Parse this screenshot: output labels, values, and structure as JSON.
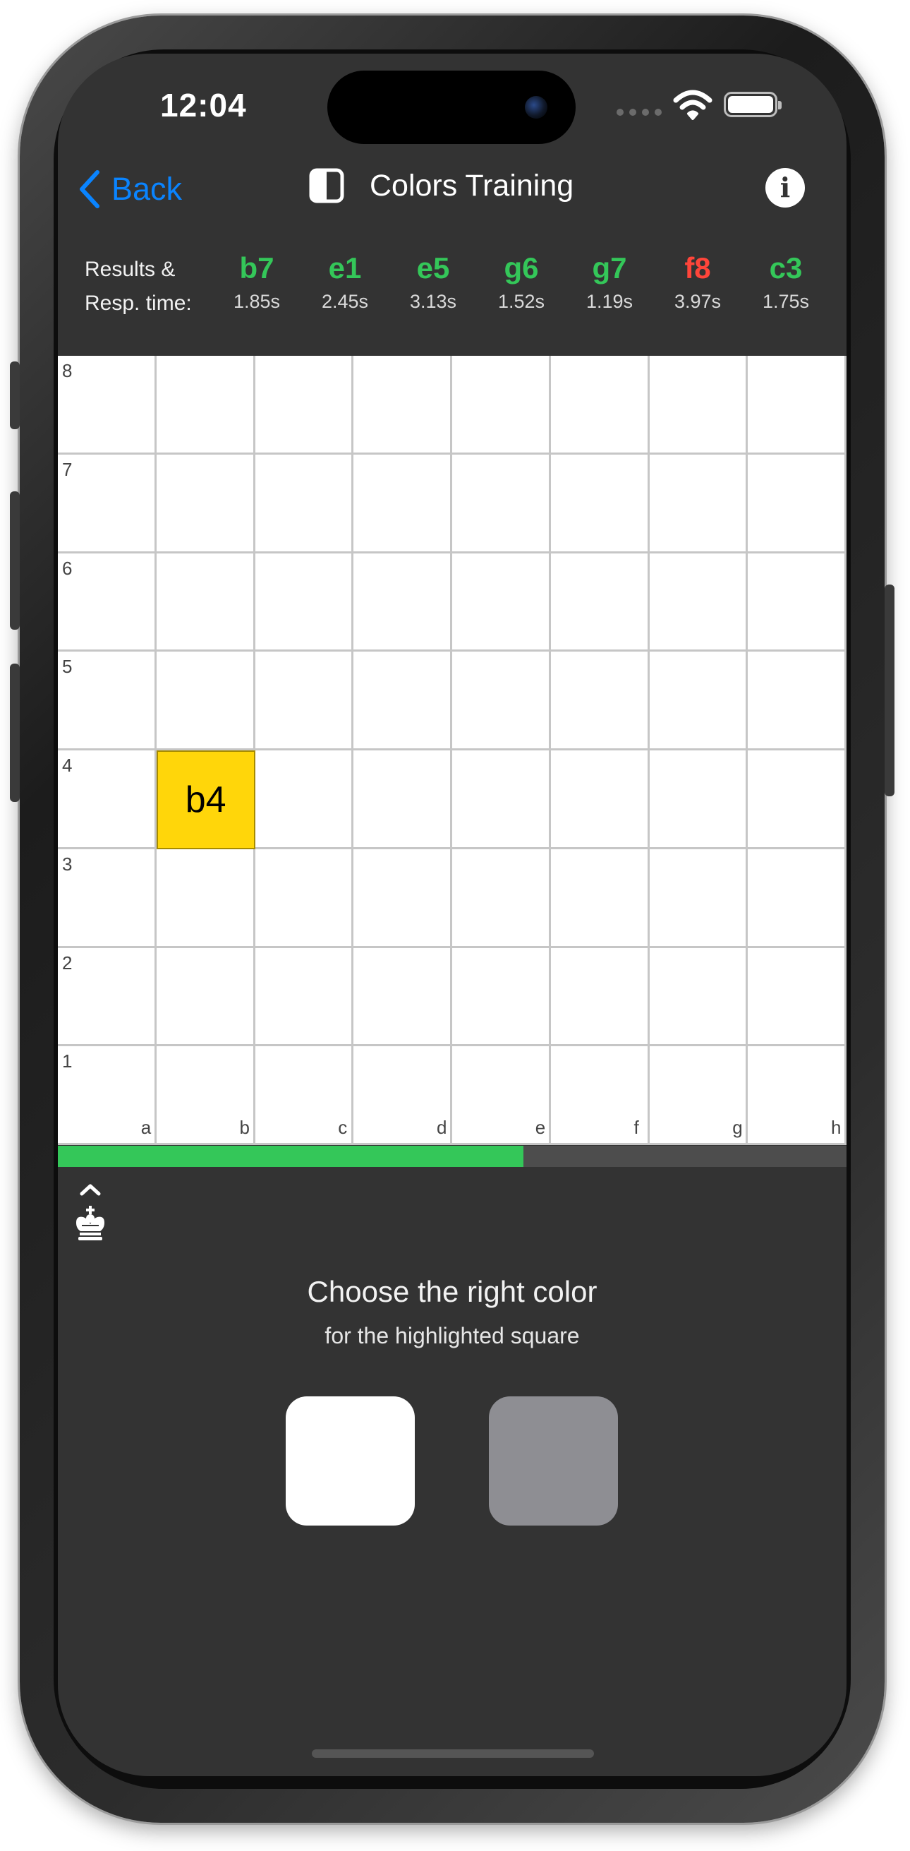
{
  "status_bar": {
    "time": "12:04"
  },
  "nav": {
    "back_label": "Back",
    "title": "Colors Training",
    "info_label": "i"
  },
  "results": {
    "label_line1": "Results &",
    "label_line2": "Resp. time:",
    "items": [
      {
        "square": "b7",
        "time": "1.85s",
        "correct": true
      },
      {
        "square": "e1",
        "time": "2.45s",
        "correct": true
      },
      {
        "square": "e5",
        "time": "3.13s",
        "correct": true
      },
      {
        "square": "g6",
        "time": "1.52s",
        "correct": true
      },
      {
        "square": "g7",
        "time": "1.19s",
        "correct": true
      },
      {
        "square": "f8",
        "time": "3.97s",
        "correct": false
      },
      {
        "square": "c3",
        "time": "1.75s",
        "correct": true
      }
    ]
  },
  "board": {
    "files": [
      "a",
      "b",
      "c",
      "d",
      "e",
      "f",
      "g",
      "h"
    ],
    "ranks": [
      "8",
      "7",
      "6",
      "5",
      "4",
      "3",
      "2",
      "1"
    ],
    "highlighted_square": "b4",
    "highlight_label": "b4"
  },
  "progress": {
    "fraction": 0.59
  },
  "prompt": {
    "title": "Choose the right color",
    "subtitle": "for the highlighted square"
  },
  "choices": [
    {
      "name": "white",
      "color": "#ffffff"
    },
    {
      "name": "gray",
      "color": "#8e8e93"
    }
  ],
  "colors": {
    "accent": "#0a84ff",
    "correct": "#34c759",
    "wrong": "#ff453a",
    "highlight": "#ffd60a",
    "background": "#333333"
  }
}
